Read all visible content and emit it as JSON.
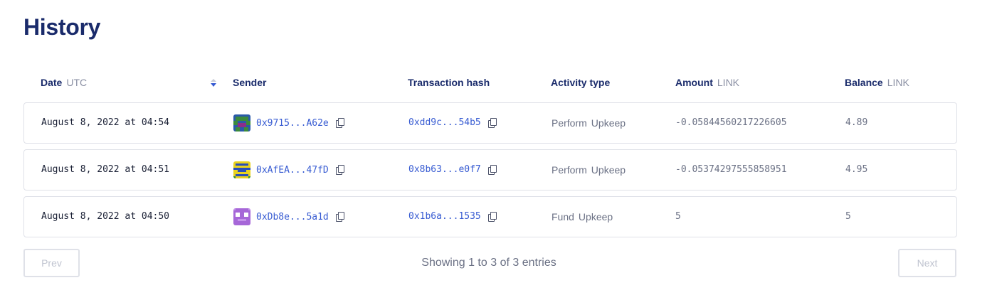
{
  "page": {
    "title": "History"
  },
  "table": {
    "columns": {
      "date": {
        "label": "Date",
        "unit": "UTC"
      },
      "sender": {
        "label": "Sender"
      },
      "hash": {
        "label": "Transaction hash"
      },
      "activity": {
        "label": "Activity type"
      },
      "amount": {
        "label": "Amount",
        "unit": "LINK"
      },
      "balance": {
        "label": "Balance",
        "unit": "LINK"
      }
    },
    "sort": {
      "column": "date",
      "direction": "descending"
    },
    "rows": [
      {
        "date": "August 8, 2022 at 04:54",
        "sender": "0x9715...A62e",
        "hash": "0xdd9c...54b5",
        "activity": [
          "Perform",
          "Upkeep"
        ],
        "amount": "-0.05844560217226605",
        "balance": "4.89"
      },
      {
        "date": "August 8, 2022 at 04:51",
        "sender": "0xAfEA...47fD",
        "hash": "0x8b63...e0f7",
        "activity": [
          "Perform",
          "Upkeep"
        ],
        "amount": "-0.05374297555858951",
        "balance": "4.95"
      },
      {
        "date": "August 8, 2022 at 04:50",
        "sender": "0xDb8e...5a1d",
        "hash": "0x1b6a...1535",
        "activity": [
          "Fund",
          "Upkeep"
        ],
        "amount": "5",
        "balance": "5"
      }
    ]
  },
  "pagination": {
    "prev": "Prev",
    "next": "Next",
    "status": "Showing 1 to 3 of 3 entries"
  },
  "colors": {
    "heading": "#1a2b6b",
    "link": "#375bd2",
    "muted": "#6b7185",
    "border": "#dfe1e8"
  },
  "icons": {
    "copy": "copy-icon",
    "sort": "sort-desc-icon"
  }
}
